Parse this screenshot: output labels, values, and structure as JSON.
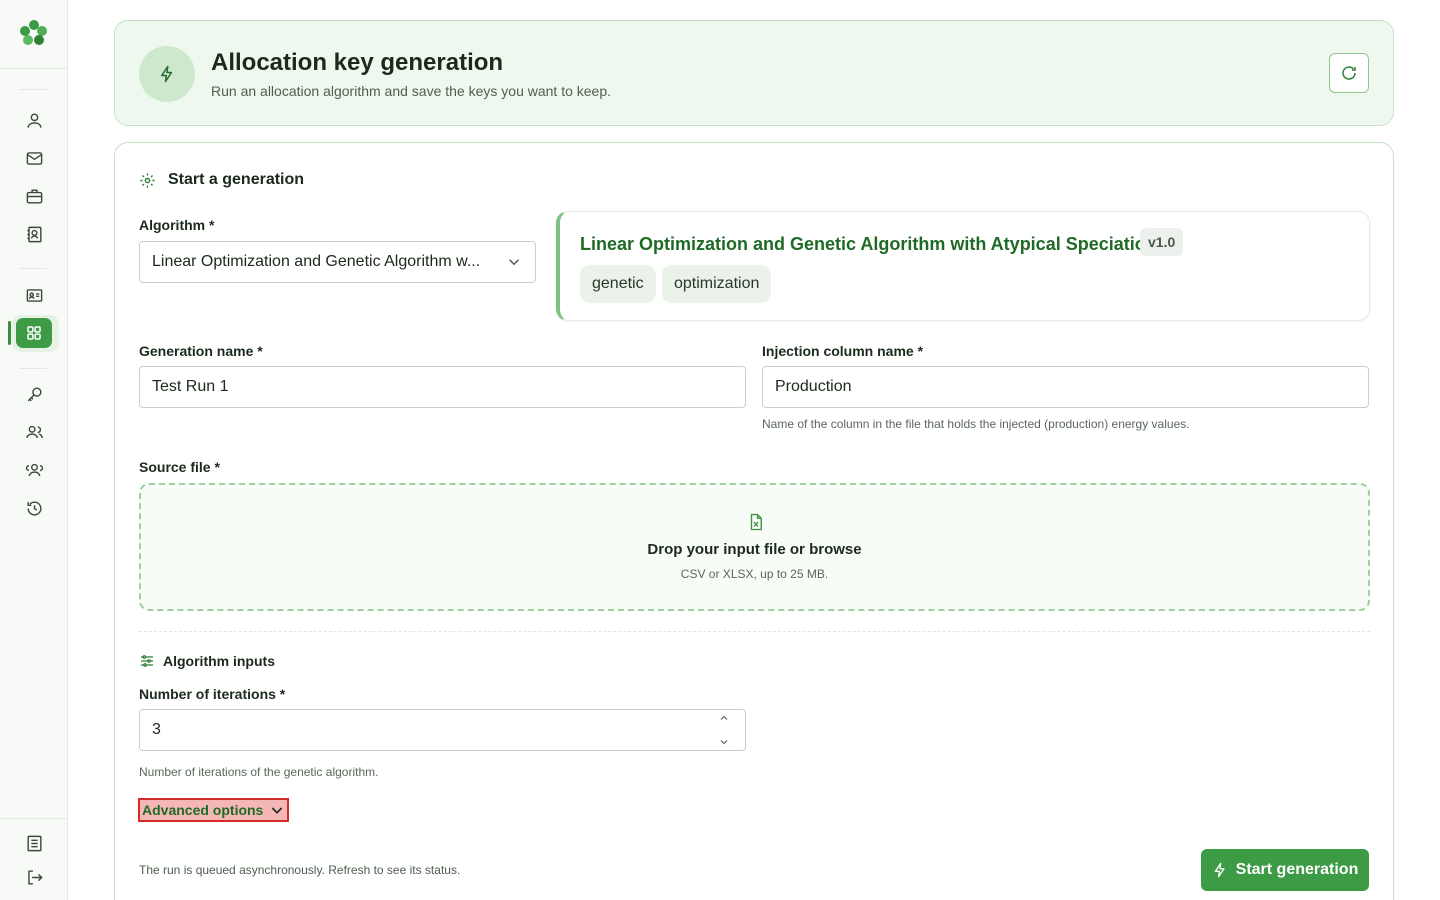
{
  "sidebar": {
    "icons": [
      "user-icon",
      "mail-icon",
      "briefcase-icon",
      "contacts-icon",
      "id-card-icon",
      "grid-icon",
      "key-icon",
      "users-icon",
      "group-icon",
      "history-icon",
      "document-icon",
      "logout-icon"
    ]
  },
  "header": {
    "title": "Allocation key generation",
    "subtitle": "Run an allocation algorithm and save the keys you want to keep."
  },
  "form": {
    "section_title": "Start a generation",
    "algorithm_label": "Algorithm *",
    "algorithm_value": "Linear Optimization and Genetic Algorithm w...",
    "algorithm_card": {
      "name": "Linear Optimization and Genetic Algorithm with Atypical Speciation",
      "version": "v1.0",
      "tags": [
        "genetic",
        "optimization"
      ]
    },
    "generation_name_label": "Generation name *",
    "generation_name_value": "Test Run 1",
    "injection_label": "Injection column name *",
    "injection_value": "Production",
    "injection_hint": "Name of the column in the file that holds the injected (production) energy values.",
    "source_label": "Source file *",
    "dropzone_title": "Drop your input file or browse",
    "dropzone_sub": "CSV or XLSX, up to 25 MB.",
    "algo_inputs_title": "Algorithm inputs",
    "iterations_label": "Number of iterations *",
    "iterations_value": "3",
    "iterations_hint": "Number of iterations of the genetic algorithm.",
    "advanced_label": "Advanced options",
    "footer_note": "The run is queued asynchronously. Refresh to see its status.",
    "start_label": "Start generation"
  },
  "colors": {
    "accent": "#3d9a45",
    "header_bg": "#eff8ef",
    "highlight": "#d42a2a"
  }
}
